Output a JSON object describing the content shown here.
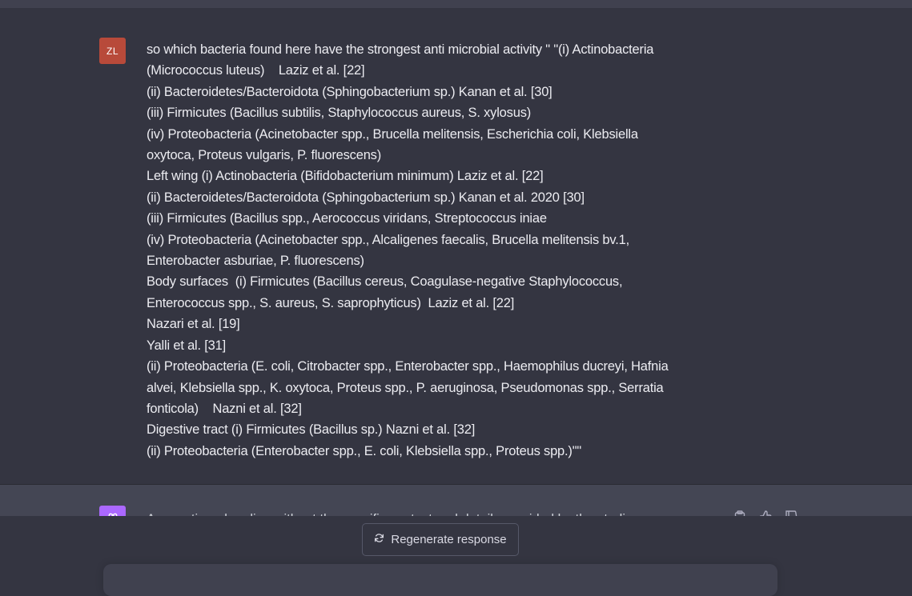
{
  "user": {
    "avatar_initials": "ZL",
    "lines": [
      "so which bacteria found here have the strongest anti microbial activity \" \"(i) Actinobacteria",
      "(Micrococcus luteus)    Laziz et al. [22]",
      "(ii) Bacteroidetes/Bacteroidota (Sphingobacterium sp.) Kanan et al. [30]",
      "(iii) Firmicutes (Bacillus subtilis, Staphylococcus aureus, S. xylosus)",
      "(iv) Proteobacteria (Acinetobacter spp., Brucella melitensis, Escherichia coli, Klebsiella",
      "oxytoca, Proteus vulgaris, P. fluorescens)",
      "Left wing (i) Actinobacteria (Bifidobacterium minimum) Laziz et al. [22]",
      "(ii) Bacteroidetes/Bacteroidota (Sphingobacterium sp.) Kanan et al. 2020 [30]",
      "(iii) Firmicutes (Bacillus spp., Aerococcus viridans, Streptococcus iniae",
      "(iv) Proteobacteria (Acinetobacter spp., Alcaligenes faecalis, Brucella melitensis bv.1,",
      "Enterobacter asburiae, P. fluorescens)",
      "Body surfaces  (i) Firmicutes (Bacillus cereus, Coagulase-negative Staphylococcus,",
      "Enterococcus spp., S. aureus, S. saprophyticus)  Laziz et al. [22]",
      "Nazari et al. [19]",
      "Yalli et al. [31]",
      "(ii) Proteobacteria (E. coli, Citrobacter spp., Enterobacter spp., Haemophilus ducreyi, Hafnia",
      "alvei, Klebsiella spp., K. oxytoca, Proteus spp., P. aeruginosa, Pseudomonas spp., Serratia",
      "fonticola)    Nazni et al. [32]",
      "Digestive tract (i) Firmicutes (Bacillus sp.) Nazni et al. [32]",
      "(ii) Proteobacteria (Enterobacter spp., E. coli, Klebsiella spp., Proteus spp.)\"\""
    ]
  },
  "assistant": {
    "partial_text": "As mentioned earlier, without the specific context and details provided by the studies"
  },
  "controls": {
    "regenerate_label": "Regenerate response"
  },
  "icons": {
    "copy": "clipboard-icon",
    "thumbs_up": "thumbs-up-icon",
    "thumbs_down": "thumbs-down-icon",
    "regenerate": "refresh-icon",
    "assistant_avatar": "openai-logo-icon"
  },
  "colors": {
    "background": "#343541",
    "assistant_background": "#444654",
    "user_avatar": "#b84a3a",
    "assistant_avatar": "#ab68ff"
  }
}
